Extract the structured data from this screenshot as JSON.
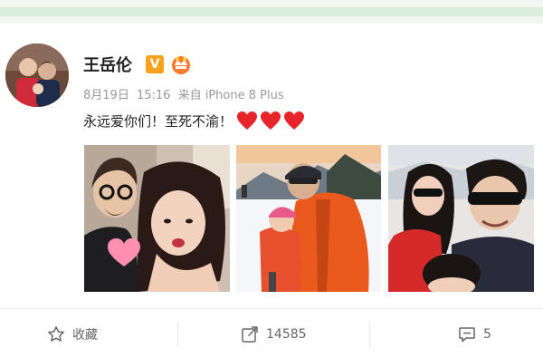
{
  "post": {
    "author": "王岳伦",
    "date": "8月19日",
    "time": "15:16",
    "source": "来自 iPhone 8 Plus",
    "text": "永远爱你们！至死不渝！",
    "verified_badge": "V",
    "emoji": [
      "heart",
      "heart",
      "heart"
    ]
  },
  "actions": {
    "favorite_label": "收藏",
    "repost_count": "14585",
    "comment_count": "5"
  },
  "colors": {
    "accent": "#f7a21b",
    "heart": "#e8242b",
    "meta": "#999999"
  },
  "icons": [
    "star-outline-icon",
    "repost-icon",
    "comment-icon",
    "vip-crown-icon",
    "verified-v-icon"
  ]
}
